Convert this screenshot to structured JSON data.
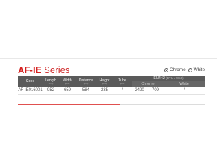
{
  "series": {
    "code": "AF-IE",
    "label": " Series"
  },
  "finish": {
    "options": [
      {
        "label": "Chrome",
        "selected": true
      },
      {
        "label": "White",
        "selected": false
      }
    ]
  },
  "table": {
    "headers": [
      {
        "label": "Code",
        "unit": ""
      },
      {
        "label": "Length",
        "unit": "(mm)"
      },
      {
        "label": "Width",
        "unit": "(mm)"
      },
      {
        "label": "Distance",
        "unit": "(mm)"
      },
      {
        "label": "Height",
        "unit": "(mm)"
      },
      {
        "label": "Tube",
        "unit": "(mm)"
      }
    ],
    "standard": {
      "label": "EN442",
      "units": "(BTU / Watt)"
    },
    "sub_headers": [
      "Chrome",
      "White"
    ],
    "rows": [
      {
        "code": "AF-IE016001",
        "length": "952",
        "width": "659",
        "distance": "584",
        "height": "235",
        "tube": "/",
        "chrome_btu": "2420",
        "chrome_watt": "709",
        "white": "/"
      }
    ]
  }
}
